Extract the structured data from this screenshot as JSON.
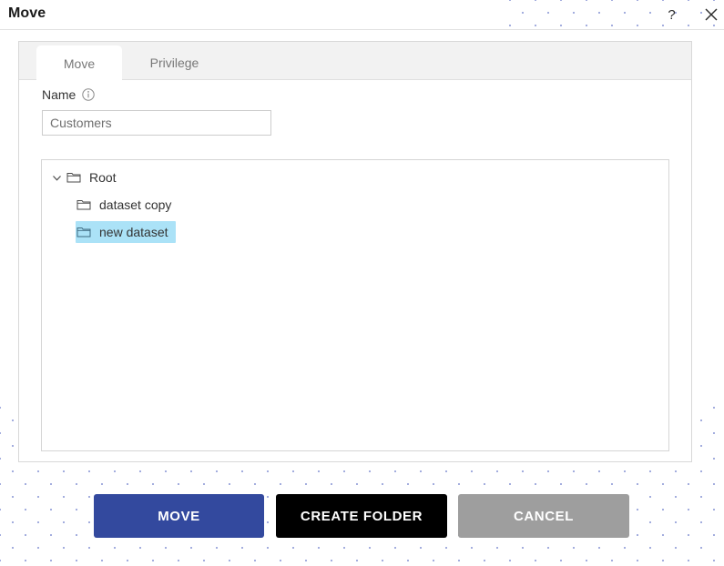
{
  "window": {
    "title": "Move",
    "help_icon": "question-mark-icon",
    "close_icon": "close-icon"
  },
  "tabs": [
    {
      "id": "move",
      "label": "Move",
      "active": true
    },
    {
      "id": "privilege",
      "label": "Privilege",
      "active": false
    }
  ],
  "form": {
    "name_label": "Name",
    "info_icon": "info-circle-icon",
    "name_value": "Customers",
    "name_placeholder": ""
  },
  "tree": {
    "nodes": [
      {
        "id": "root",
        "label": "Root",
        "icon": "folder-icon",
        "expander": "chevron-down-icon",
        "expanded": true,
        "depth": 0,
        "selected": false
      },
      {
        "id": "dataset-copy",
        "label": "dataset copy",
        "icon": "folder-icon",
        "depth": 1,
        "selected": false
      },
      {
        "id": "new-dataset",
        "label": "new dataset",
        "icon": "folder-icon",
        "depth": 1,
        "selected": true
      }
    ],
    "selection_color": "#abe2f7"
  },
  "buttons": {
    "move": "MOVE",
    "create_folder": "CREATE FOLDER",
    "cancel": "CANCEL"
  },
  "colors": {
    "primary_blue": "#33499e",
    "black": "#000000",
    "gray": "#9e9e9e",
    "tab_strip_bg": "#f2f2f2",
    "dot_pattern": "#a3adde"
  }
}
